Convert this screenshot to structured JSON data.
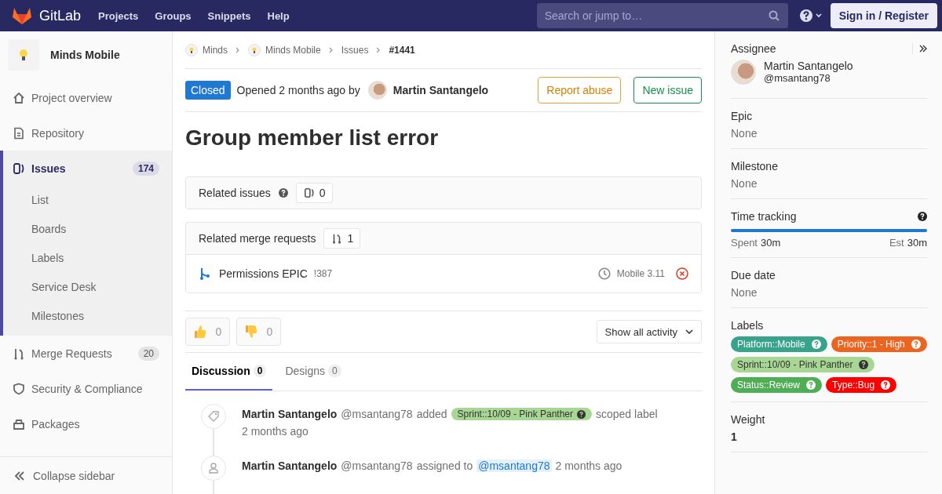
{
  "nav": {
    "logo": "GitLab",
    "links": [
      "Projects",
      "Groups",
      "Snippets",
      "Help"
    ],
    "search": {
      "placeholder": "Search or jump to…"
    },
    "sign_in": "Sign in / Register"
  },
  "sidebar": {
    "project": "Minds Mobile",
    "items": [
      {
        "label": "Project overview",
        "kind": "home",
        "selected": false
      },
      {
        "label": "Repository",
        "kind": "doc",
        "selected": false
      },
      {
        "label": "Issues",
        "kind": "issues",
        "selected": true,
        "count": "174",
        "children": [
          {
            "label": "List",
            "selected": false
          },
          {
            "label": "Boards",
            "selected": false
          },
          {
            "label": "Labels",
            "selected": false
          },
          {
            "label": "Service Desk",
            "selected": false
          },
          {
            "label": "Milestones",
            "selected": false
          }
        ]
      },
      {
        "label": "Merge Requests",
        "kind": "merge",
        "selected": false,
        "count": "20"
      },
      {
        "label": "Security & Compliance",
        "kind": "shield",
        "selected": false
      },
      {
        "label": "Packages",
        "kind": "package",
        "selected": false
      }
    ],
    "collapse": "Collapse sidebar"
  },
  "breadcrumbs": [
    {
      "label": "Minds",
      "kind": "avatar"
    },
    {
      "label": "Minds Mobile",
      "kind": "avatar"
    },
    {
      "label": "Issues",
      "kind": "plain"
    },
    {
      "label": "#1441",
      "kind": "current"
    }
  ],
  "issue": {
    "status": "Closed",
    "opened": "Opened 2 months ago by",
    "author": "Martin Santangelo",
    "buttons": [
      {
        "label": "Report abuse",
        "kind": "warning"
      },
      {
        "label": "New issue",
        "kind": "success"
      }
    ],
    "title": "Group member list error"
  },
  "related_issues": {
    "title": "Related issues",
    "count": "0"
  },
  "related_mrs": {
    "title": "Related merge requests",
    "count": "1",
    "items": [
      {
        "title": "Permissions EPIC",
        "ref": "!387",
        "milestone": "Mobile 3.11"
      }
    ]
  },
  "awards": [
    {
      "kind": "thumbsup",
      "count": "0"
    },
    {
      "kind": "thumbsdown",
      "count": "0"
    }
  ],
  "activity_filter": "Show all activity",
  "tabs": [
    {
      "label": "Discussion",
      "count": "0",
      "selected": true
    },
    {
      "label": "Designs",
      "count": "0",
      "selected": false
    }
  ],
  "timeline": [
    {
      "kind": "label",
      "author": "Martin Santangelo",
      "handle": "@msantang78",
      "action": "added",
      "label": {
        "text": "Sprint::10/09 - Pink Panther",
        "color": "#a8d695"
      },
      "suffix": "scoped label",
      "time": "2 months ago"
    },
    {
      "kind": "assign",
      "author": "Martin Santangelo",
      "handle": "@msantang78",
      "action": "assigned to",
      "mention": "@msantang78",
      "time": "2 months ago"
    }
  ],
  "right": {
    "assignee": {
      "title": "Assignee",
      "name": "Martin Santangelo",
      "handle": "@msantang78"
    },
    "epic": {
      "title": "Epic",
      "value": "None"
    },
    "milestone": {
      "title": "Milestone",
      "value": "None"
    },
    "time_tracking": {
      "title": "Time tracking",
      "level": 1,
      "spent_label": "Spent",
      "spent": "30m",
      "est_label": "Est",
      "est": "30m"
    },
    "due_date": {
      "title": "Due date",
      "value": "None"
    },
    "labels": {
      "title": "Labels",
      "items": [
        {
          "text": "Platform::Mobile",
          "color": "#37a38a"
        },
        {
          "text": "Priority::1 - High",
          "color": "#eb6420"
        },
        {
          "text": "Sprint::10/09 - Pink Panther",
          "color": "#a8d695"
        },
        {
          "text": "Status::Review",
          "color": "#4fae54"
        },
        {
          "text": "Type::Bug",
          "color": "#ff0000"
        }
      ]
    },
    "weight": {
      "title": "Weight",
      "value": "1"
    }
  }
}
